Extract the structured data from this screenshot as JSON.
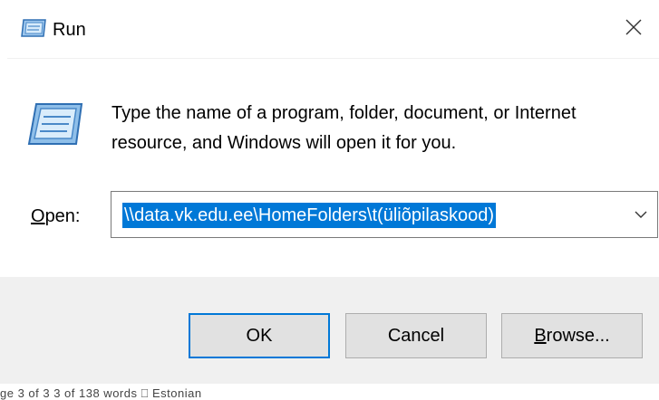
{
  "window": {
    "title": "Run",
    "close_glyph": "✕"
  },
  "icons": {
    "title": "run-icon",
    "main": "run-icon-large",
    "close": "close-icon",
    "dropdown": "chevron-down-icon"
  },
  "description": "Type the name of a program, folder, document, or Internet resource, and Windows will open it for you.",
  "open_field": {
    "label_accel": "O",
    "label_rest": "pen:",
    "value": "\\\\data.vk.edu.ee\\HomeFolders\\t(üliõpilaskood)"
  },
  "buttons": {
    "ok": "OK",
    "cancel": "Cancel",
    "browse_accel": "B",
    "browse_rest": "rowse..."
  },
  "background_status": "ge 3 of 3    3 of 138 words    ⎕    Estonian",
  "colors": {
    "accent": "#0078d7",
    "footer_bg": "#f0f0f0",
    "button_bg": "#e1e1e1"
  }
}
